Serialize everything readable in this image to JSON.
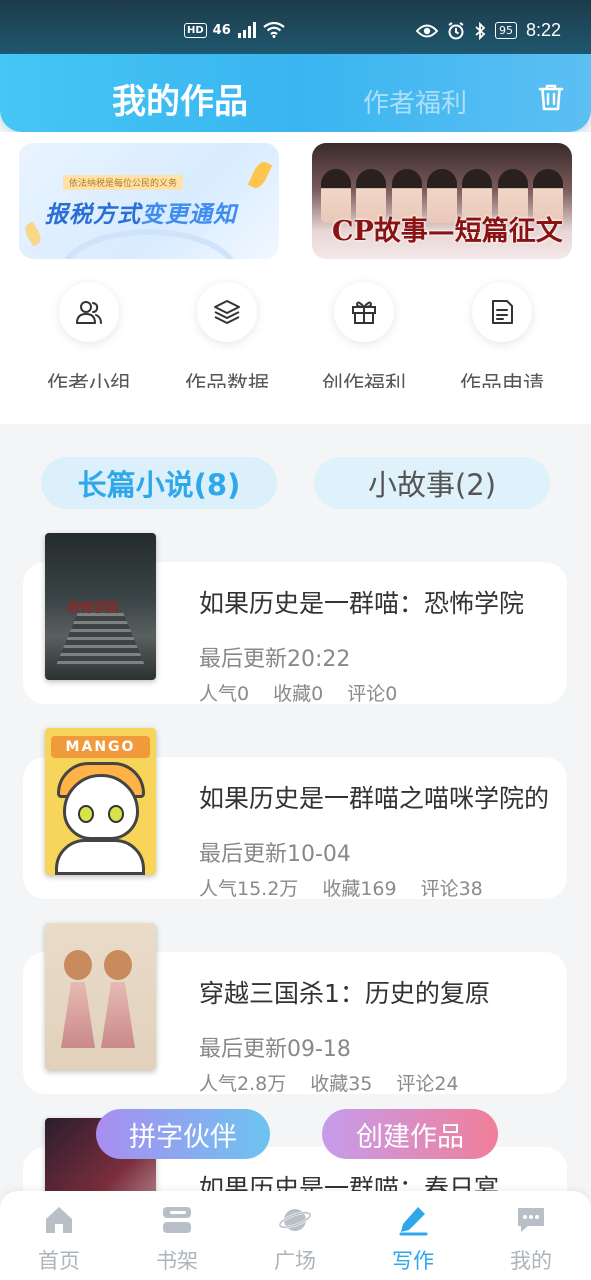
{
  "status_bar": {
    "hd": "HD",
    "network": "46",
    "battery": "95",
    "time": "8:22"
  },
  "header": {
    "tab_active": "我的作品",
    "tab_other": "作者福利"
  },
  "banners": [
    {
      "small_text": "依法纳税是每位公民的义务",
      "text_main": "报税方式",
      "text_highlight": "变更通知"
    },
    {
      "title": "CP故事—短篇征文"
    }
  ],
  "functions": [
    {
      "label": "作者小组",
      "icon": "people-icon"
    },
    {
      "label": "作品数据",
      "icon": "layers-icon"
    },
    {
      "label": "创作福利",
      "icon": "gift-icon"
    },
    {
      "label": "作品申请",
      "icon": "document-icon"
    }
  ],
  "categories": [
    {
      "label": "长篇小说(8)",
      "active": true
    },
    {
      "label": "小故事(2)",
      "active": false
    }
  ],
  "works": [
    {
      "title": "如果历史是一群喵：恐怖学院",
      "update": "最后更新20:22",
      "popularity": "人气0",
      "favorites": "收藏0",
      "comments": "评论0",
      "cover_text": "恐怖学院"
    },
    {
      "title": "如果历史是一群喵之喵咪学院的",
      "update": "最后更新10-04",
      "popularity": "人气15.2万",
      "favorites": "收藏169",
      "comments": "评论38",
      "cover_text": "MANGO"
    },
    {
      "title": "穿越三国杀1：历史的复原",
      "update": "最后更新09-18",
      "popularity": "人气2.8万",
      "favorites": "收藏35",
      "comments": "评论24"
    },
    {
      "title": "如果历史是一群喵：春日宴"
    }
  ],
  "floating": {
    "left": "拼字伙伴",
    "right": "创建作品"
  },
  "bottom_nav": [
    {
      "label": "首页",
      "icon": "home-icon"
    },
    {
      "label": "书架",
      "icon": "bookshelf-icon"
    },
    {
      "label": "广场",
      "icon": "planet-icon"
    },
    {
      "label": "写作",
      "icon": "pen-icon",
      "active": true
    },
    {
      "label": "我的",
      "icon": "chat-icon"
    }
  ],
  "colors": {
    "accent": "#2fa8ea",
    "header_gradient_start": "#45c6f4",
    "fab_create_end": "#f07f98"
  }
}
